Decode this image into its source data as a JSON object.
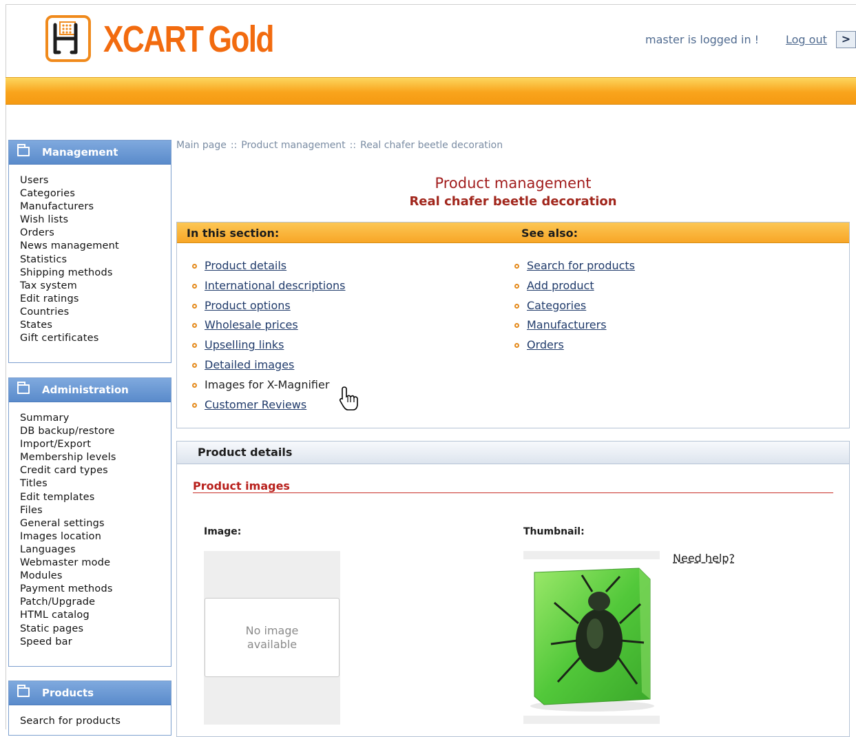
{
  "header": {
    "logo_main": "XCART",
    "logo_edition": "Gold",
    "login_status": "master is logged in !",
    "logout_label": "Log out",
    "logout_button": ">"
  },
  "sidebar": {
    "management": {
      "title": "Management",
      "items": [
        "Users",
        "Categories",
        "Manufacturers",
        "Wish lists",
        "Orders",
        "News management",
        "Statistics",
        "Shipping methods",
        "Tax system",
        "Edit ratings",
        "Countries",
        "States",
        "Gift certificates"
      ]
    },
    "administration": {
      "title": "Administration",
      "items": [
        "Summary",
        "DB backup/restore",
        "Import/Export",
        "Membership levels",
        "Credit card types",
        "Titles",
        "Edit templates",
        "Files",
        "General settings",
        "Images location",
        "Languages",
        "Webmaster mode",
        "Modules",
        "Payment methods",
        "Patch/Upgrade",
        "HTML catalog",
        "Static pages",
        "Speed bar"
      ]
    },
    "products": {
      "title": "Products",
      "items": [
        "Search for products"
      ]
    }
  },
  "breadcrumb": {
    "items": [
      "Main page",
      "Product management",
      "Real chafer beetle decoration"
    ],
    "separator": "::"
  },
  "page": {
    "title": "Product management",
    "subtitle": "Real chafer beetle decoration"
  },
  "section": {
    "in_this_section_label": "In this section:",
    "see_also_label": "See also:",
    "in_this_section": [
      "Product details",
      "International descriptions",
      "Product options",
      "Wholesale prices",
      "Upselling links",
      "Detailed images",
      "Images for X-Magnifier",
      "Customer Reviews"
    ],
    "see_also": [
      "Search for products",
      "Add product",
      "Categories",
      "Manufacturers",
      "Orders"
    ]
  },
  "details": {
    "panel_title": "Product details",
    "product_images_label": "Product images",
    "image_label": "Image:",
    "thumbnail_label": "Thumbnail:",
    "no_image_line1": "No image",
    "no_image_line2": "available",
    "need_help": "Need help?"
  },
  "colors": {
    "accent_orange": "#f9a41c",
    "menu_blue": "#5a8bcb",
    "title_red": "#a11c1c",
    "link_blue": "#1f3a6a"
  }
}
